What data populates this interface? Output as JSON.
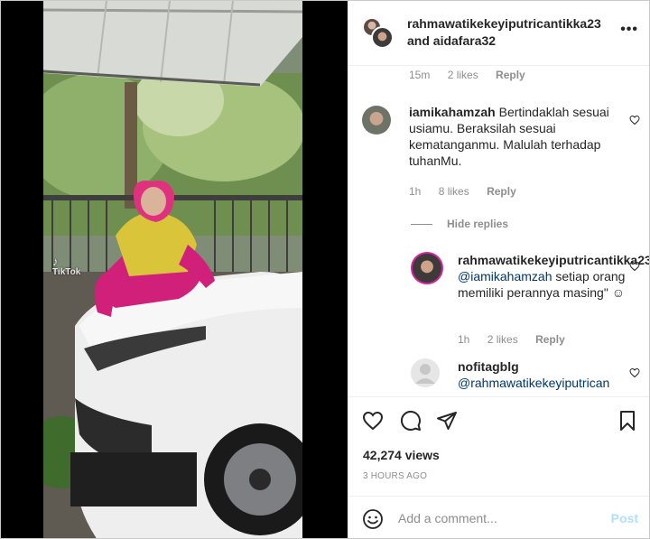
{
  "media": {
    "watermark": "TikTok",
    "watermark_icon": "tiktok-note-icon"
  },
  "header": {
    "user1": "rahmawatikekeyiputricantikka23",
    "and_text": "and aidafara32",
    "more_icon": "more-options-icon",
    "more_label": "•••"
  },
  "comments": [
    {
      "meta": {
        "time": "15m",
        "likes": "2 likes",
        "reply": "Reply"
      }
    },
    {
      "user": "iamikahamzah",
      "text": "Bertindaklah sesuai usiamu. Beraksilah sesuai kematanganmu. Malulah terhadap tuhanMu.",
      "meta": {
        "time": "1h",
        "likes": "8 likes",
        "reply": "Reply"
      }
    }
  ],
  "hide_replies": "Hide replies",
  "replies": [
    {
      "user": "rahmawatikekeyiputricantikka23",
      "mention": "@iamikahamzah",
      "text": " setiap orang memiliki perannya masing\" ☺",
      "meta": {
        "time": "1h",
        "likes": "2 likes",
        "reply": "Reply"
      }
    },
    {
      "user": "nofitagblg",
      "mention": "@rahmawatikekeyiputrican"
    }
  ],
  "actions": {
    "like_icon": "heart-icon",
    "comment_icon": "comment-bubble-icon",
    "share_icon": "share-plane-icon",
    "save_icon": "bookmark-icon"
  },
  "views": "42,274 views",
  "posted": "3 HOURS AGO",
  "add_comment": {
    "placeholder": "Add a comment...",
    "post_label": "Post",
    "emoji_icon": "emoji-icon"
  },
  "colors": {
    "link": "#00376b",
    "muted": "#8e8e8e",
    "post_disabled": "#b2dffc"
  }
}
